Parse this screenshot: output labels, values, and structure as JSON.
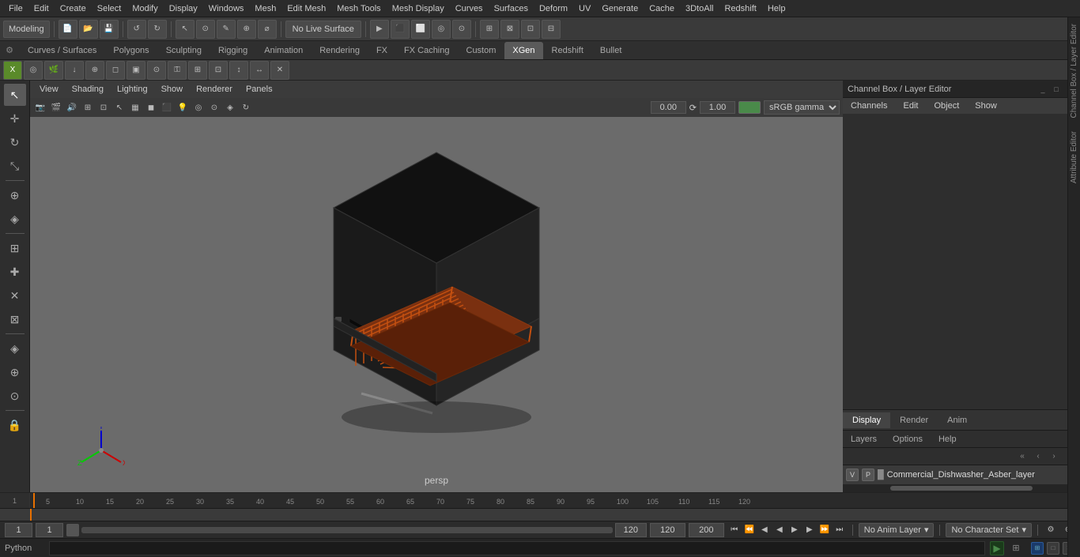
{
  "app": {
    "title": "Autodesk Maya"
  },
  "menu": {
    "items": [
      "File",
      "Edit",
      "Create",
      "Select",
      "Modify",
      "Display",
      "Windows",
      "Mesh",
      "Edit Mesh",
      "Mesh Tools",
      "Mesh Display",
      "Curves",
      "Surfaces",
      "Deform",
      "UV",
      "Generate",
      "Cache",
      "3DtoAll",
      "Redshift",
      "Help"
    ]
  },
  "toolbar1": {
    "mode_dropdown": "Modeling",
    "live_surface_btn": "No Live Surface",
    "undo_label": "⎌",
    "redo_label": "↻"
  },
  "tabs": {
    "items": [
      "Curves / Surfaces",
      "Polygons",
      "Sculpting",
      "Rigging",
      "Animation",
      "Rendering",
      "FX",
      "FX Caching",
      "Custom",
      "XGen",
      "Redshift",
      "Bullet"
    ],
    "active": "XGen"
  },
  "sidebar": {
    "icons": [
      "↖",
      "⊕",
      "✎",
      "↻",
      "⤡",
      "▦",
      "✚",
      "✕"
    ]
  },
  "viewport": {
    "menu_items": [
      "View",
      "Shading",
      "Lighting",
      "Show",
      "Renderer",
      "Panels"
    ],
    "persp_label": "persp",
    "rotation_x": "0.00",
    "rotation_y": "1.00",
    "color_space": "sRGB gamma"
  },
  "right_panel": {
    "title": "Channel Box / Layer Editor",
    "channels_menu": [
      "Channels",
      "Edit",
      "Object",
      "Show"
    ],
    "display_tabs": [
      "Display",
      "Render",
      "Anim"
    ],
    "active_display_tab": "Display",
    "layers_menu": [
      "Layers",
      "Options",
      "Help"
    ],
    "layer_buttons": [
      "«",
      "‹",
      "›",
      "»"
    ],
    "layer": {
      "v": "V",
      "p": "P",
      "name": "Commercial_Dishwasher_Asber_layer"
    }
  },
  "timeline": {
    "ticks": [
      "",
      "5",
      "10",
      "15",
      "20",
      "25",
      "30",
      "35",
      "40",
      "45",
      "50",
      "55",
      "60",
      "65",
      "70",
      "75",
      "80",
      "85",
      "90",
      "95",
      "100",
      "105",
      "110",
      "115",
      "120"
    ]
  },
  "status_bar": {
    "current_frame": "1",
    "frame_input": "1",
    "range_display": "120",
    "range_end": "200",
    "anim_layer": "No Anim Layer",
    "char_set": "No Character Set",
    "playback": {
      "go_start": "⏮",
      "prev_key": "⏪",
      "prev_frame": "◀",
      "play_back": "▶",
      "play_fwd": "▶",
      "next_frame": "▶",
      "next_key": "⏩",
      "go_end": "⏭"
    }
  },
  "python_bar": {
    "label": "Python",
    "placeholder": ""
  },
  "edge_panels": {
    "right": [
      "Channel Box / Layer Editor",
      "Attribute Editor"
    ]
  }
}
